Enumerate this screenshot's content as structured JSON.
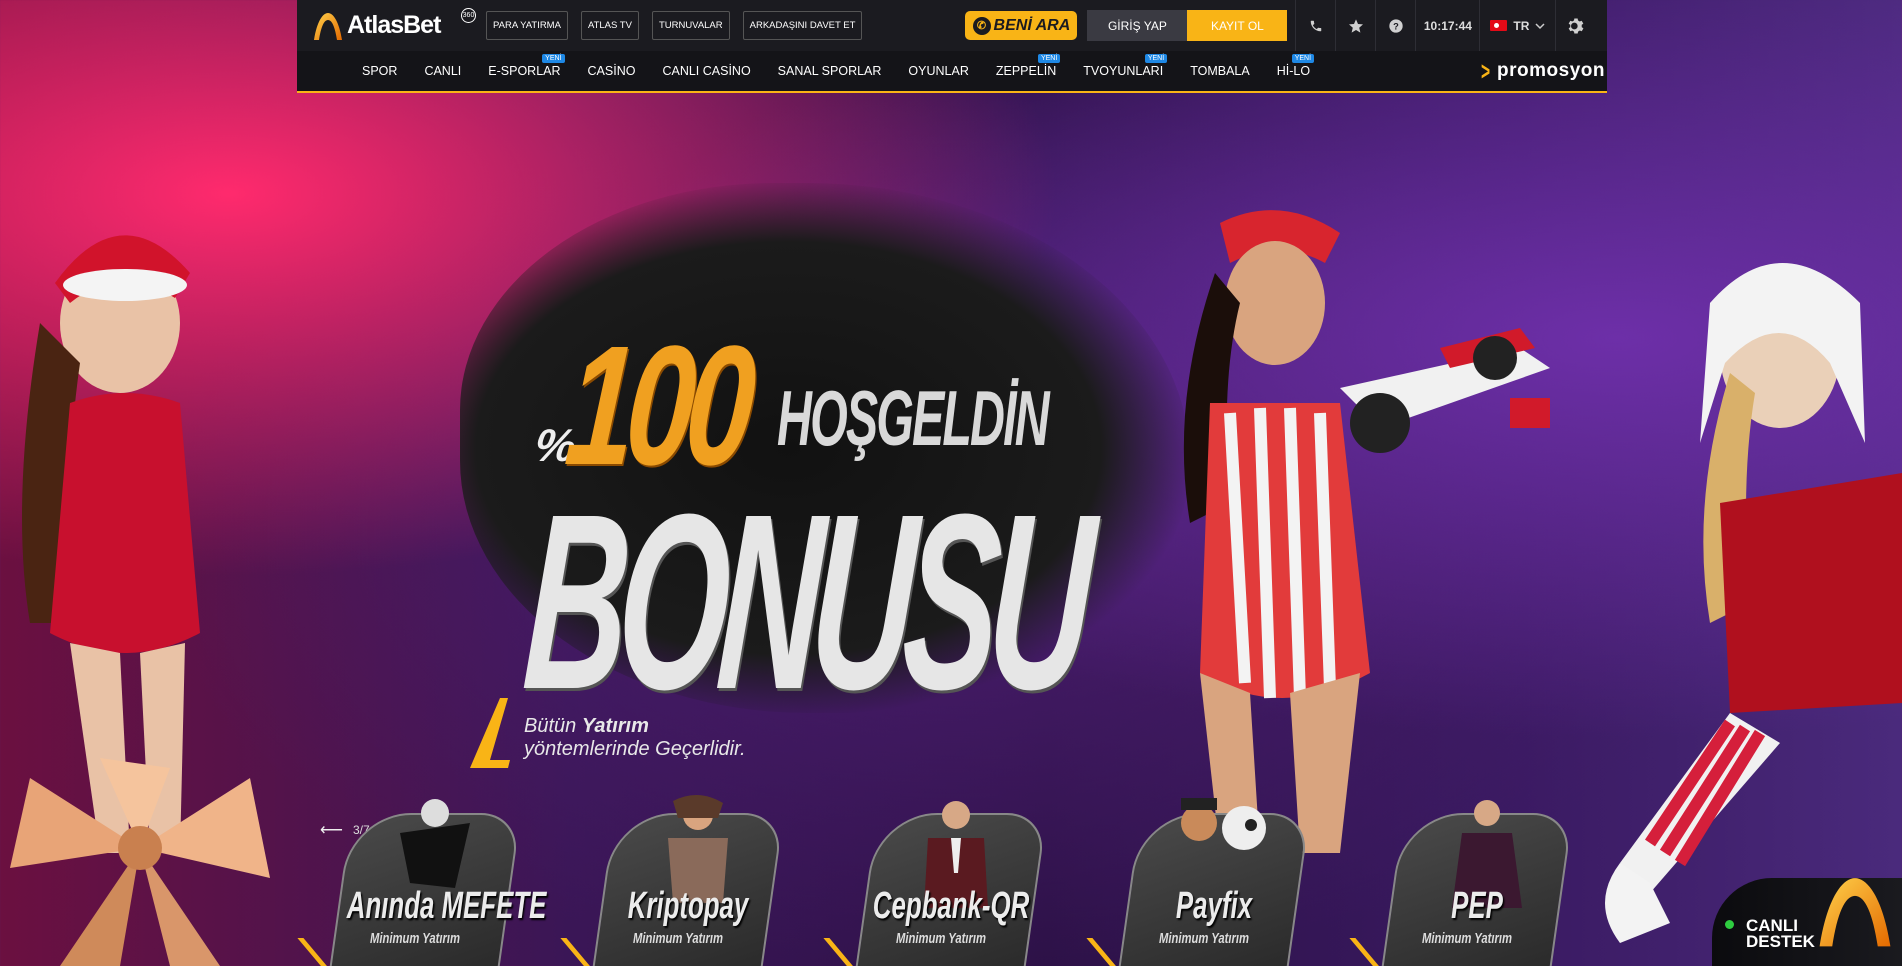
{
  "brand": {
    "name": "AtlasBet",
    "badge": "360"
  },
  "top_links": [
    {
      "label": "PARA YATIRMA"
    },
    {
      "label": "ATLAS TV"
    },
    {
      "label": "TURNUVALAR"
    },
    {
      "label": "ARKADAŞINI DAVET ET"
    }
  ],
  "callback": {
    "label": "BENİ ARA"
  },
  "auth": {
    "login": "GİRİŞ YAP",
    "register": "KAYIT OL"
  },
  "clock": "10:17:44",
  "language": "TR",
  "nav": [
    {
      "label": "SPOR",
      "badge": ""
    },
    {
      "label": "CANLI",
      "badge": ""
    },
    {
      "label": "E-SPORLAR",
      "badge": "YENİ"
    },
    {
      "label": "CASİNO",
      "badge": ""
    },
    {
      "label": "CANLI CASİNO",
      "badge": ""
    },
    {
      "label": "SANAL SPORLAR",
      "badge": ""
    },
    {
      "label": "OYUNLAR",
      "badge": ""
    },
    {
      "label": "ZEPPELİN",
      "badge": "YENİ"
    },
    {
      "label": "TVOYUNLARI",
      "badge": "YENİ"
    },
    {
      "label": "TOMBALA",
      "badge": ""
    },
    {
      "label": "Hİ-LO",
      "badge": "YENİ"
    }
  ],
  "promo": {
    "label": "promosyon"
  },
  "banner": {
    "percent": "%",
    "amount": "100",
    "word1": "HOŞGELDİN",
    "word2": "BONUSU",
    "sub_line1_a": "Bütün ",
    "sub_line1_b": "Yatırım",
    "sub_line2": "yöntemlerinde Geçerlidir.",
    "slide": "3/7"
  },
  "payments": [
    {
      "name": "Anında MEFETE",
      "min": "Minimum Yatırım"
    },
    {
      "name": "Kriptopay",
      "min": "Minimum Yatırım"
    },
    {
      "name": "Cepbank-QR",
      "min": "Minimum Yatırım"
    },
    {
      "name": "Payfix",
      "min": "Minimum Yatırım"
    },
    {
      "name": "PEP",
      "min": "Minimum Yatırım"
    }
  ],
  "support": {
    "line1": "CANLI",
    "line2": "DESTEK"
  },
  "colors": {
    "accent": "#f9b416",
    "header": "#1b1b20",
    "nav": "#141418",
    "badge": "#1e88e5",
    "online": "#2ecc40"
  },
  "icons": [
    "phone-icon",
    "star-icon",
    "help-icon",
    "chevron-down-icon",
    "gear-icon",
    "arrow-left-icon",
    "arrow-right-icon"
  ]
}
